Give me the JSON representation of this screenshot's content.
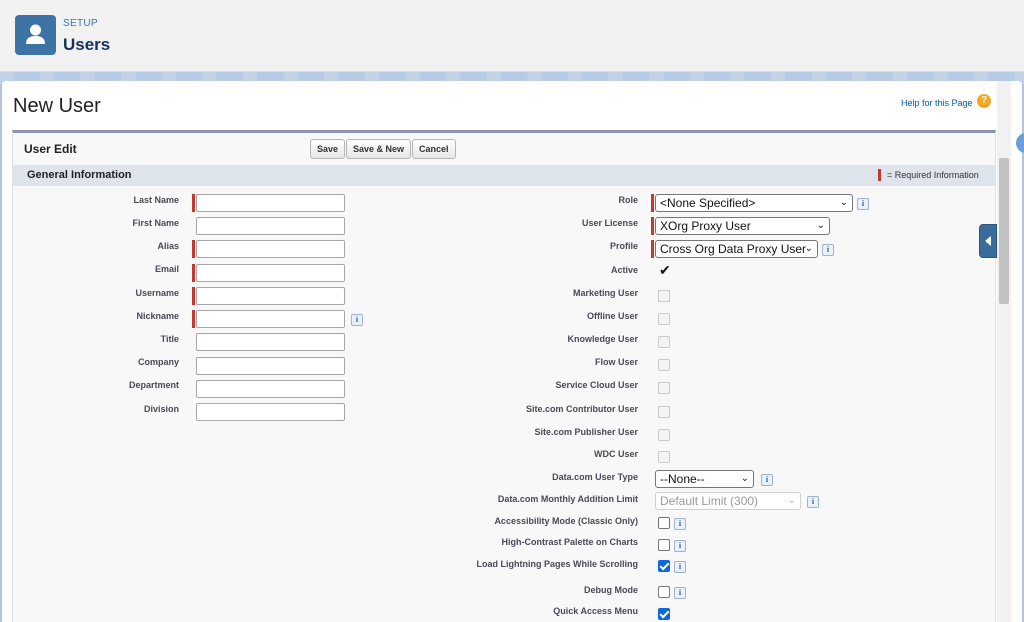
{
  "header": {
    "section_label": "SETUP",
    "page_name": "Users"
  },
  "page": {
    "title": "New User",
    "help_link": "Help for this Page",
    "help_icon_glyph": "?"
  },
  "form": {
    "title": "User Edit",
    "buttons": {
      "save": "Save",
      "save_new": "Save & New",
      "cancel": "Cancel"
    },
    "section_title": "General Information",
    "required_legend": "= Required Information"
  },
  "left_fields": [
    {
      "label": "Last Name",
      "value": "",
      "required": true
    },
    {
      "label": "First Name",
      "value": "",
      "required": false
    },
    {
      "label": "Alias",
      "value": "",
      "required": true
    },
    {
      "label": "Email",
      "value": "",
      "required": true
    },
    {
      "label": "Username",
      "value": "",
      "required": true
    },
    {
      "label": "Nickname",
      "value": "",
      "required": true
    },
    {
      "label": "Title",
      "value": "",
      "required": false
    },
    {
      "label": "Company",
      "value": "",
      "required": false
    },
    {
      "label": "Department",
      "value": "",
      "required": false
    },
    {
      "label": "Division",
      "value": "",
      "required": false
    }
  ],
  "right_fields": {
    "role": {
      "label": "Role",
      "value": "<None Specified>"
    },
    "user_license": {
      "label": "User License",
      "value": "XOrg Proxy User"
    },
    "profile": {
      "label": "Profile",
      "value": "Cross Org Data Proxy User"
    },
    "active": {
      "label": "Active",
      "glyph": "✔"
    },
    "marketing_user": {
      "label": "Marketing User",
      "checked": false
    },
    "offline_user": {
      "label": "Offline User",
      "checked": false
    },
    "knowledge_user": {
      "label": "Knowledge User",
      "checked": false
    },
    "flow_user": {
      "label": "Flow User",
      "checked": false
    },
    "service_cloud_user": {
      "label": "Service Cloud User",
      "checked": false
    },
    "site_contributor": {
      "label": "Site.com Contributor User",
      "checked": false
    },
    "site_publisher": {
      "label": "Site.com Publisher User",
      "checked": false
    },
    "wdc_user": {
      "label": "WDC User",
      "checked": false
    },
    "datacom_user_type": {
      "label": "Data.com User Type",
      "value": "--None--"
    },
    "datacom_monthly_limit": {
      "label": "Data.com Monthly Addition Limit",
      "value": "Default Limit (300)"
    },
    "accessibility_mode": {
      "label": "Accessibility Mode (Classic Only)",
      "checked": false
    },
    "high_contrast": {
      "label": "High-Contrast Palette on Charts",
      "checked": false
    },
    "load_lightning_pages": {
      "label": "Load Lightning Pages While Scrolling",
      "checked": true
    },
    "debug_mode": {
      "label": "Debug Mode",
      "checked": false
    },
    "quick_access_menu": {
      "label": "Quick Access Menu",
      "checked": true
    }
  },
  "icons": {
    "info_glyph": "i",
    "chevron_glyph": "⌄"
  }
}
